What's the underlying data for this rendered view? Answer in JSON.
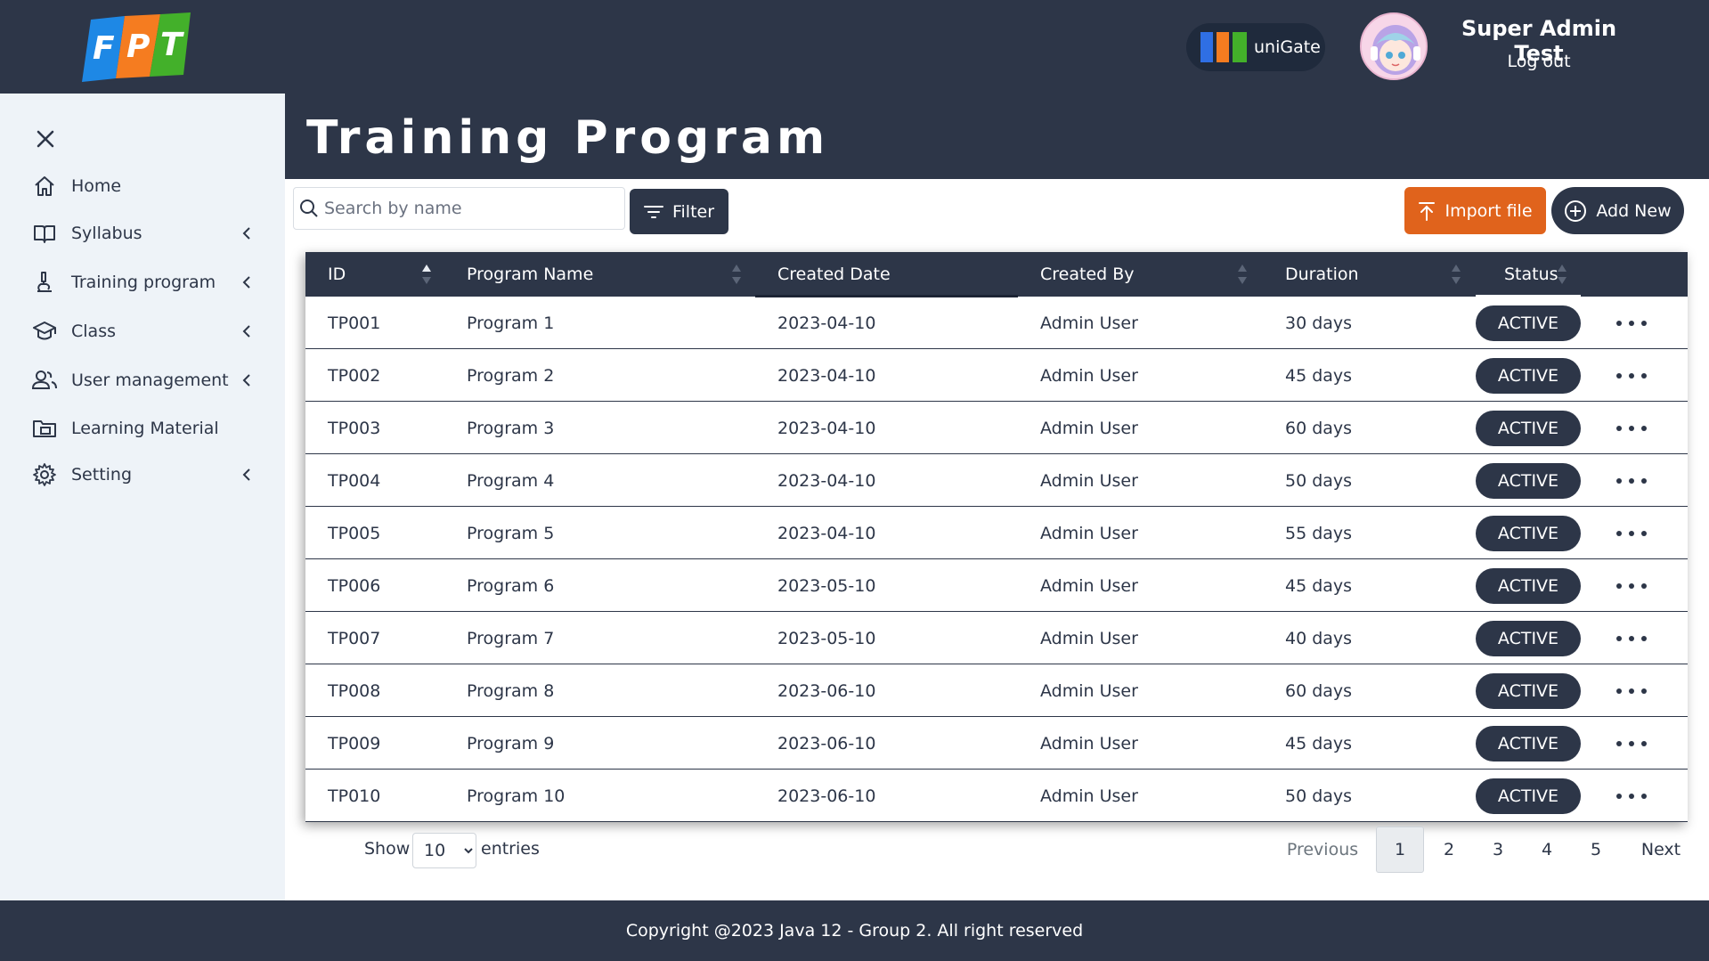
{
  "header": {
    "logo_text": "FPT",
    "unigate_label": "uniGate",
    "user_name": "Super Admin Test",
    "logout_label": "Log out"
  },
  "sidebar": {
    "items": [
      {
        "label": "Home",
        "icon": "home-icon",
        "has_submenu": false
      },
      {
        "label": "Syllabus",
        "icon": "book-icon",
        "has_submenu": true
      },
      {
        "label": "Training program",
        "icon": "microscope-icon",
        "has_submenu": true
      },
      {
        "label": "Class",
        "icon": "graduation-cap-icon",
        "has_submenu": true
      },
      {
        "label": "User management",
        "icon": "users-icon",
        "has_submenu": true
      },
      {
        "label": "Learning Material",
        "icon": "folder-icon",
        "has_submenu": false
      },
      {
        "label": "Setting",
        "icon": "gear-icon",
        "has_submenu": true
      }
    ]
  },
  "main": {
    "title": "Training Program",
    "search_placeholder": "Search by name",
    "filter_label": "Filter",
    "import_label": "Import file",
    "add_label": "Add New"
  },
  "table": {
    "columns": [
      "ID",
      "Program Name",
      "Created Date",
      "Created By",
      "Duration",
      "Status"
    ],
    "rows": [
      {
        "id": "TP001",
        "name": "Program 1",
        "date": "2023-04-10",
        "by": "Admin User",
        "duration": "30 days",
        "status": "ACTIVE"
      },
      {
        "id": "TP002",
        "name": "Program 2",
        "date": "2023-04-10",
        "by": "Admin User",
        "duration": "45 days",
        "status": "ACTIVE"
      },
      {
        "id": "TP003",
        "name": "Program 3",
        "date": "2023-04-10",
        "by": "Admin User",
        "duration": "60 days",
        "status": "ACTIVE"
      },
      {
        "id": "TP004",
        "name": "Program 4",
        "date": "2023-04-10",
        "by": "Admin User",
        "duration": "50 days",
        "status": "ACTIVE"
      },
      {
        "id": "TP005",
        "name": "Program 5",
        "date": "2023-04-10",
        "by": "Admin User",
        "duration": "55 days",
        "status": "ACTIVE"
      },
      {
        "id": "TP006",
        "name": "Program 6",
        "date": "2023-05-10",
        "by": "Admin User",
        "duration": "45 days",
        "status": "ACTIVE"
      },
      {
        "id": "TP007",
        "name": "Program 7",
        "date": "2023-05-10",
        "by": "Admin User",
        "duration": "40 days",
        "status": "ACTIVE"
      },
      {
        "id": "TP008",
        "name": "Program 8",
        "date": "2023-06-10",
        "by": "Admin User",
        "duration": "60 days",
        "status": "ACTIVE"
      },
      {
        "id": "TP009",
        "name": "Program 9",
        "date": "2023-06-10",
        "by": "Admin User",
        "duration": "45 days",
        "status": "ACTIVE"
      },
      {
        "id": "TP010",
        "name": "Program 10",
        "date": "2023-06-10",
        "by": "Admin User",
        "duration": "50 days",
        "status": "ACTIVE"
      }
    ]
  },
  "pagination": {
    "show_label": "Show",
    "entries_value": "10",
    "entries_label": "entries",
    "previous_label": "Previous",
    "pages": [
      "1",
      "2",
      "3",
      "4",
      "5"
    ],
    "current_page": "1",
    "next_label": "Next"
  },
  "footer": {
    "text": "Copyright @2023 Java 12 - Group 2. All right reserved"
  },
  "colors": {
    "primary_dark": "#2d3648",
    "accent_orange": "#e0631c",
    "sidebar_bg": "#eef3f8"
  }
}
